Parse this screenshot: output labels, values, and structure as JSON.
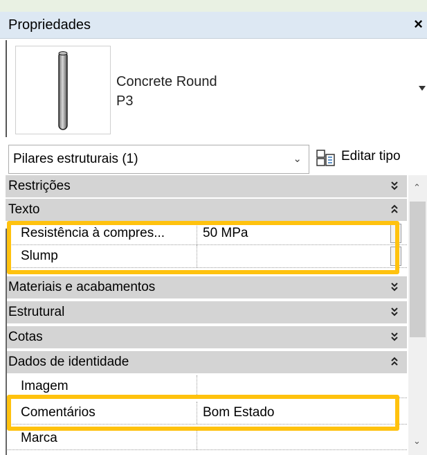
{
  "panel": {
    "title": "Propriedades",
    "close_glyph": "×"
  },
  "type_selector": {
    "family": "Concrete Round",
    "type": "P3"
  },
  "instance_filter": {
    "label": "Pilares estruturais (1)",
    "chevron": "⌄"
  },
  "edit_type": {
    "label": "Editar tipo",
    "icon": "edit-type-icon"
  },
  "categories": {
    "restricoes": {
      "label": "Restrições",
      "state": "collapsed"
    },
    "texto": {
      "label": "Texto",
      "state": "expanded"
    },
    "materiais": {
      "label": "Materiais e acabamentos",
      "state": "collapsed"
    },
    "estrutural": {
      "label": "Estrutural",
      "state": "collapsed"
    },
    "cotas": {
      "label": "Cotas",
      "state": "collapsed"
    },
    "identidade": {
      "label": "Dados de identidade",
      "state": "expanded"
    }
  },
  "properties": {
    "resistencia": {
      "name": "Resistência à compres...",
      "value": "50 MPa"
    },
    "slump": {
      "name": "Slump",
      "value": ""
    },
    "imagem": {
      "name": "Imagem",
      "value": ""
    },
    "comentarios": {
      "name": "Comentários",
      "value": "Bom Estado"
    },
    "marca": {
      "name": "Marca",
      "value": ""
    }
  },
  "colors": {
    "highlight": "#ffc20e",
    "category_bg": "#d4d4d4",
    "titlebar_bg": "#dde8f3"
  }
}
